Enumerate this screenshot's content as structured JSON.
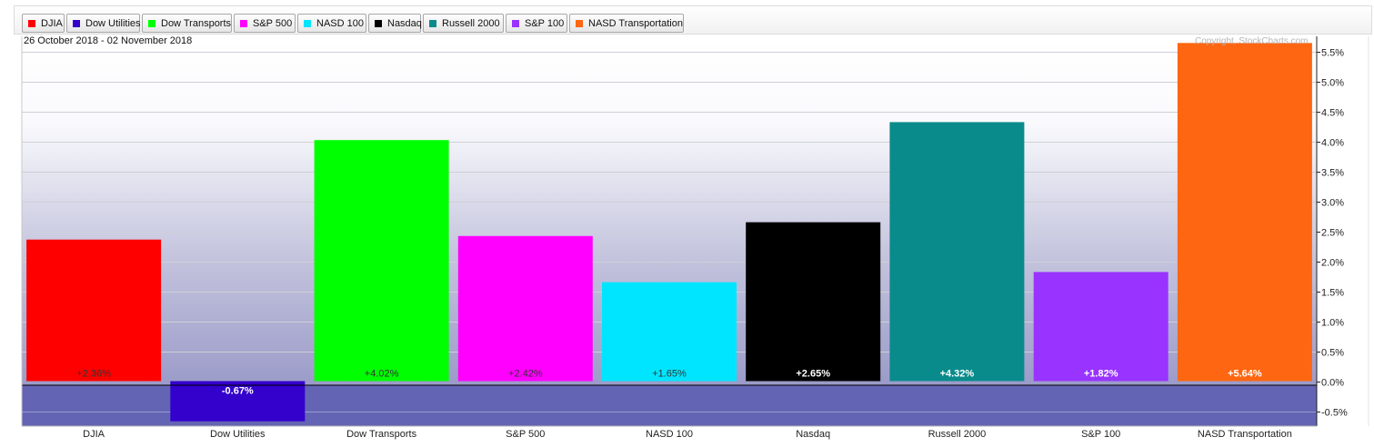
{
  "chart_data": {
    "type": "bar",
    "date_range": "26 October 2018 - 02 November 2018",
    "copyright": "Copyright, StockCharts.com",
    "categories": [
      "DJIA",
      "Dow Utilities",
      "Dow Transports",
      "S&P 500",
      "NASD 100",
      "Nasdaq",
      "Russell 2000",
      "S&P 100",
      "NASD Transportation"
    ],
    "values": [
      2.36,
      -0.67,
      4.02,
      2.42,
      1.65,
      2.65,
      4.32,
      1.82,
      5.64
    ],
    "value_labels": [
      "+2.36%",
      "-0.67%",
      "+4.02%",
      "+2.42%",
      "+1.65%",
      "+2.65%",
      "+4.32%",
      "+1.82%",
      "+5.64%"
    ],
    "colors": [
      "#ff0000",
      "#3300cc",
      "#00ff00",
      "#ff00ff",
      "#00e5ff",
      "#000000",
      "#0a8b8b",
      "#9933ff",
      "#ff6611"
    ],
    "label_colors": [
      "#333333",
      "#ffffff",
      "#333333",
      "#333333",
      "#333333",
      "#ffffff",
      "#ffffff",
      "#ffffff",
      "#ffffff"
    ],
    "ylim": [
      -0.75,
      5.75
    ],
    "yticks": [
      -0.5,
      0.0,
      0.5,
      1.0,
      1.5,
      2.0,
      2.5,
      3.0,
      3.5,
      4.0,
      4.5,
      5.0,
      5.5
    ],
    "ytick_labels": [
      "-0.5%",
      "0.0%",
      "0.5%",
      "1.0%",
      "1.5%",
      "2.0%",
      "2.5%",
      "3.0%",
      "3.5%",
      "4.0%",
      "4.5%",
      "5.0%",
      "5.5%"
    ],
    "ylabel_position": "right",
    "grid": true,
    "legend": "top",
    "legend_items": [
      "DJIA",
      "Dow Utilities",
      "Dow Transports",
      "S&P 500",
      "NASD 100",
      "Nasdaq",
      "Russell 2000",
      "S&P 100",
      "NASD Transportation"
    ]
  }
}
